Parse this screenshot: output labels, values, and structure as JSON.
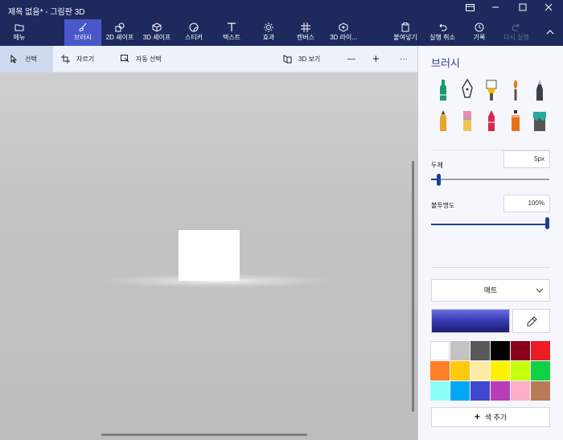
{
  "window": {
    "title": "제목 없음* - 그림판 3D"
  },
  "toolbar": {
    "items": [
      {
        "label": "메뉴",
        "icon": "folder-icon"
      },
      {
        "label": "브러시",
        "icon": "brush-icon"
      },
      {
        "label": "2D 셰이프",
        "icon": "2d-shapes-icon"
      },
      {
        "label": "3D 셰이프",
        "icon": "3d-cube-icon"
      },
      {
        "label": "스티커",
        "icon": "sticker-icon"
      },
      {
        "label": "텍스트",
        "icon": "text-icon"
      },
      {
        "label": "효과",
        "icon": "effects-sun-icon"
      },
      {
        "label": "캔버스",
        "icon": "canvas-grid-icon"
      },
      {
        "label": "3D 라이...",
        "icon": "3d-library-icon"
      },
      {
        "label": "붙여넣기",
        "icon": "paste-icon"
      },
      {
        "label": "실행 취소",
        "icon": "undo-icon"
      },
      {
        "label": "기록",
        "icon": "history-icon"
      },
      {
        "label": "다시 실행",
        "icon": "redo-icon"
      }
    ],
    "active_item": "브러시"
  },
  "subbar": {
    "select_label": "선택",
    "crop_label": "자르기",
    "magic_select_label": "자동 선택",
    "view3d_label": "3D 보기",
    "zoom_out_symbol": "—",
    "zoom_in_symbol": "+",
    "more_symbol": "···"
  },
  "panel": {
    "title": "브러시",
    "brushes": [
      {
        "name": "marker",
        "color": "#1d9a6c"
      },
      {
        "name": "calligraphy-pen",
        "color": "#3a3f4a"
      },
      {
        "name": "oil-brush",
        "color": "#f5b700"
      },
      {
        "name": "watercolor",
        "color": "#e07a1f"
      },
      {
        "name": "pixel-pen",
        "color": "#3a3f4a"
      },
      {
        "name": "pencil",
        "color": "#e8a530"
      },
      {
        "name": "eraser",
        "color": "#f08ab0"
      },
      {
        "name": "crayon",
        "color": "#d8264f"
      },
      {
        "name": "spraycan",
        "color": "#e8701c"
      },
      {
        "name": "fill",
        "color": "#27a9a0"
      }
    ],
    "thickness": {
      "label": "두께",
      "value": "5px",
      "level": 0.05
    },
    "opacity": {
      "label": "불투명도",
      "value": "100%",
      "level": 1.0
    },
    "material": {
      "selected": "매트"
    },
    "current_color": "#3a3db8",
    "palette": [
      "#ffffff",
      "#c3c3c3",
      "#585858",
      "#000000",
      "#88001b",
      "#ec1c24",
      "#ff7f27",
      "#ffc90e",
      "#fdeca6",
      "#fff200",
      "#c4ff0e",
      "#0ed145",
      "#8cfffb",
      "#00a8f3",
      "#3f48cc",
      "#b83dba",
      "#ffaec8",
      "#b97a56"
    ],
    "add_color_label": "색 추가"
  }
}
